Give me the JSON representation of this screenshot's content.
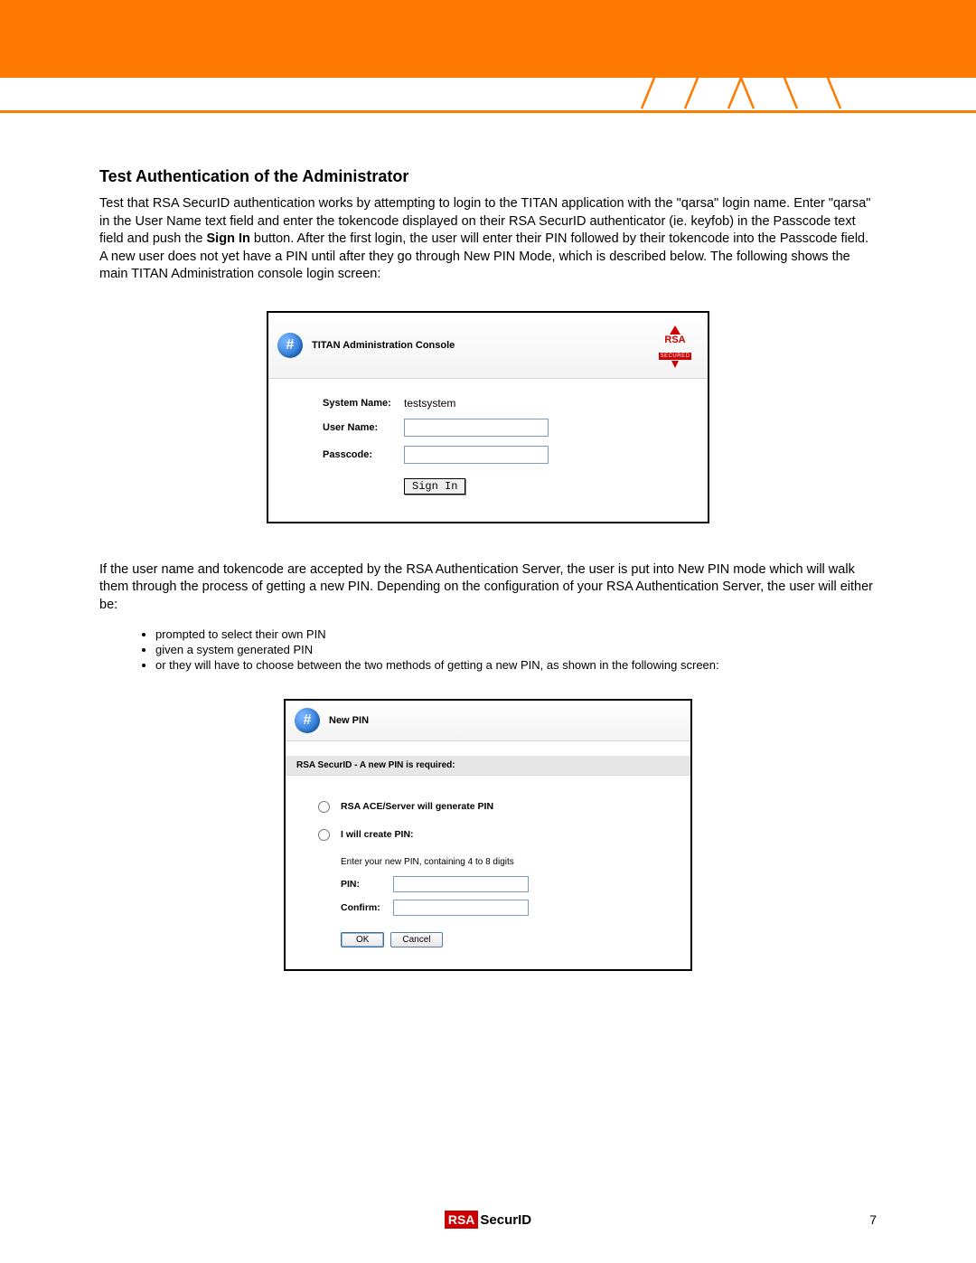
{
  "section_title": "Test Authentication of the Administrator",
  "paragraph1_a": "Test that RSA SecurID authentication works by attempting to login to the TITAN application with the \"qarsa\" login name. Enter \"qarsa\" in the User Name text field and enter the tokencode displayed on their RSA SecurID authenticator (ie. keyfob) in the Passcode text field and push the ",
  "paragraph1_bold": "Sign In",
  "paragraph1_b": " button. After the first login, the user will enter their PIN followed by their tokencode into the Passcode field.  A new user does not yet have a PIN until after they go through New PIN Mode, which is described below. The following shows the main TITAN Administration console login screen:",
  "console": {
    "title": "TITAN Administration Console",
    "rsa_brand": "RSA",
    "rsa_secured": "SECURED",
    "system_name_label": "System Name:",
    "system_name_value": "testsystem",
    "username_label": "User Name:",
    "passcode_label": "Passcode:",
    "signin": "Sign In"
  },
  "paragraph2": "If the user name and tokencode are accepted by the RSA Authentication Server, the user is put into New PIN mode which will walk them through the process of getting a new PIN. Depending on the configuration of your RSA Authentication Server, the user will either be:",
  "bullets": [
    "prompted to select their own PIN",
    "given a system generated PIN",
    "or they will have to choose between the two methods of getting a new PIN, as shown in the following screen:"
  ],
  "newpin": {
    "title": "New PIN",
    "bar": "RSA SecurID - A new PIN is required:",
    "opt1": "RSA ACE/Server will generate PIN",
    "opt2": "I will create PIN:",
    "info": "Enter your new PIN, containing 4 to 8 digits",
    "pin_label": "PIN:",
    "confirm_label": "Confirm:",
    "ok": "OK",
    "cancel": "Cancel"
  },
  "footer": {
    "rsa": "RSA",
    "securid": "SecurID"
  },
  "page_number": "7"
}
